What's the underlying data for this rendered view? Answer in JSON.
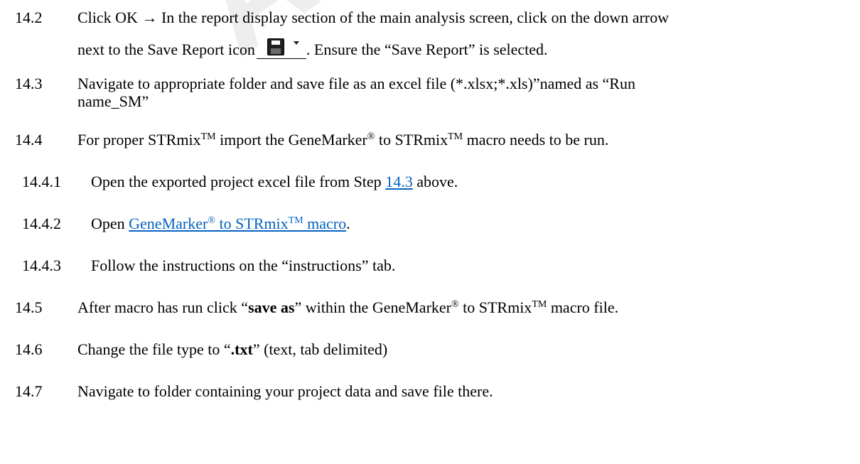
{
  "watermark": "ARC",
  "steps": {
    "s14_2": {
      "number": "14.2",
      "line1": "Click OK → In the report display section of the main analysis screen, click on the down arrow",
      "line2_a": "next to the Save Report icon",
      "line2_b": ". Ensure the “Save Report” is selected."
    },
    "s14_3": {
      "number": "14.3",
      "line1": "Navigate to appropriate folder and save file as an excel file (*.xlsx;*.xls)”named as  “Run",
      "line2": "name_SM”"
    },
    "s14_4": {
      "number": "14.4",
      "p1": "For proper STRmix",
      "tm1": "TM",
      "p2": " import the GeneMarker",
      "reg1": "®",
      "p3": " to STRmix",
      "tm2": "TM",
      "p4": " macro needs to be run."
    },
    "s14_4_1": {
      "number": "14.4.1",
      "p1": "Open the exported project excel file from Step ",
      "link": "14.3",
      "p2": " above."
    },
    "s14_4_2": {
      "number": "14.4.2",
      "p1": "Open ",
      "link_a": "GeneMarker",
      "link_reg": "®",
      "link_b": " to STRmix",
      "link_tm": "TM",
      "link_c": " macro",
      "p2": "."
    },
    "s14_4_3": {
      "number": "14.4.3",
      "text": "Follow the instructions on the “instructions” tab."
    },
    "s14_5": {
      "number": "14.5",
      "p1": "After macro has run click “",
      "bold": "save as",
      "p2": "” within the GeneMarker",
      "reg": "®",
      "p3": " to STRmix",
      "tm": "TM",
      "p4": " macro file."
    },
    "s14_6": {
      "number": "14.6",
      "p1": "Change the file type to “",
      "bold": ".txt",
      "p2": "” (text, tab delimited)"
    },
    "s14_7": {
      "number": "14.7",
      "text": "Navigate to folder containing your project data and save file there."
    }
  },
  "icons": {
    "save_report": "save-floppy-icon",
    "dropdown": "chevron-down-icon"
  }
}
